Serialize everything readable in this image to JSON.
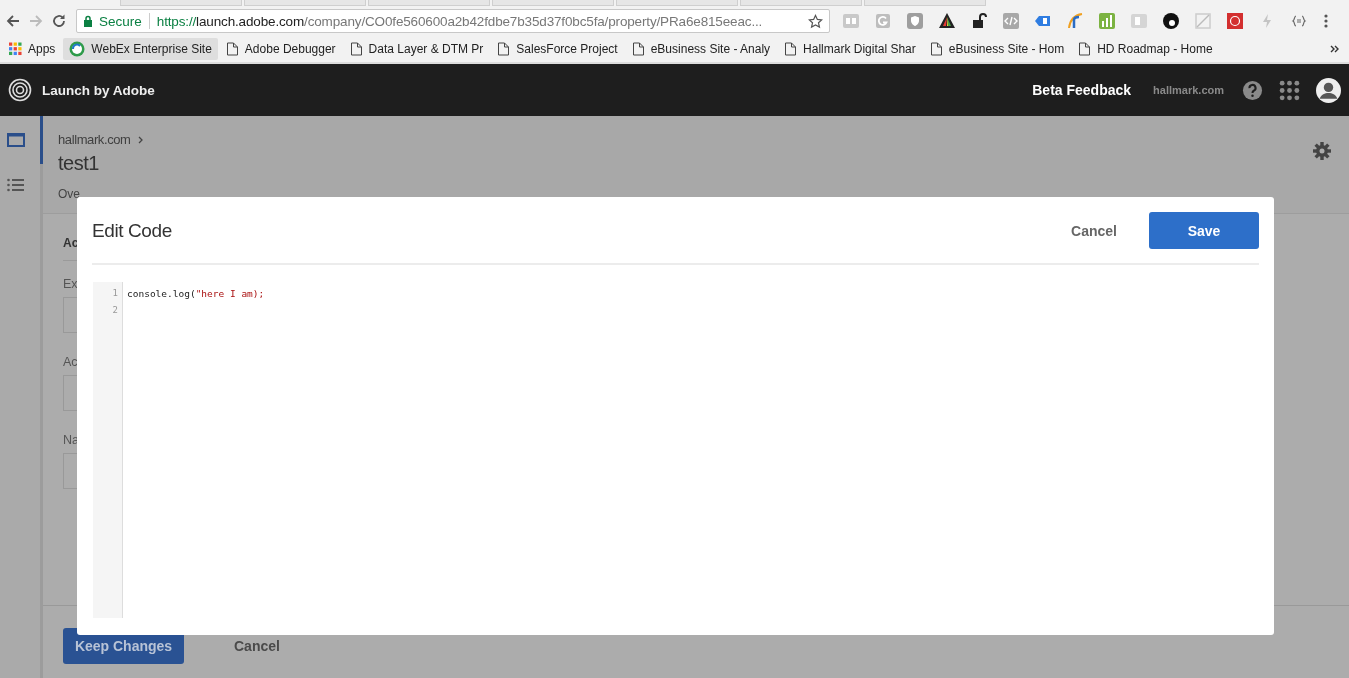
{
  "browser": {
    "security_label": "Secure",
    "url": [
      {
        "kind": "scheme",
        "text": "https://"
      },
      {
        "kind": "host",
        "text": "launch.adobe.com"
      },
      {
        "kind": "path",
        "text": "/company/CO0fe560600a2b42fdbe7b35d37f0bc5fa/property/PRa6e815eeac..."
      }
    ],
    "bookmarks": [
      {
        "label": "Apps",
        "kind": "apps",
        "selected": false
      },
      {
        "label": "WebEx Enterprise Site",
        "kind": "globe",
        "selected": true
      },
      {
        "label": "Adobe Debugger",
        "kind": "page",
        "selected": false
      },
      {
        "label": "Data Layer & DTM Pr",
        "kind": "page",
        "selected": false
      },
      {
        "label": "SalesForce Project",
        "kind": "page",
        "selected": false
      },
      {
        "label": "eBusiness Site - Analy",
        "kind": "page",
        "selected": false
      },
      {
        "label": "Hallmark Digital Shar",
        "kind": "page",
        "selected": false
      },
      {
        "label": "eBusiness Site - Hom",
        "kind": "page",
        "selected": false
      },
      {
        "label": "HD Roadmap - Home",
        "kind": "page",
        "selected": false
      }
    ]
  },
  "app_header": {
    "brand": "Launch by Adobe",
    "feedback": "Beta Feedback",
    "company": "hallmark.com"
  },
  "page": {
    "breadcrumb": "hallmark.com",
    "title": "test1",
    "tab": "Ove",
    "section_heading": "Ac",
    "fields": [
      {
        "label": "Ex"
      },
      {
        "label": "Ac"
      },
      {
        "label": "Na"
      }
    ],
    "footer": {
      "primary": "Keep Changes",
      "secondary": "Cancel"
    }
  },
  "dialog": {
    "title": "Edit Code",
    "cancel": "Cancel",
    "save": "Save",
    "lines": [
      {
        "number": "1",
        "tokens": [
          {
            "kind": "plain",
            "text": "console.log("
          },
          {
            "kind": "string",
            "text": "\"here I am);"
          }
        ]
      },
      {
        "number": "2"
      }
    ]
  }
}
